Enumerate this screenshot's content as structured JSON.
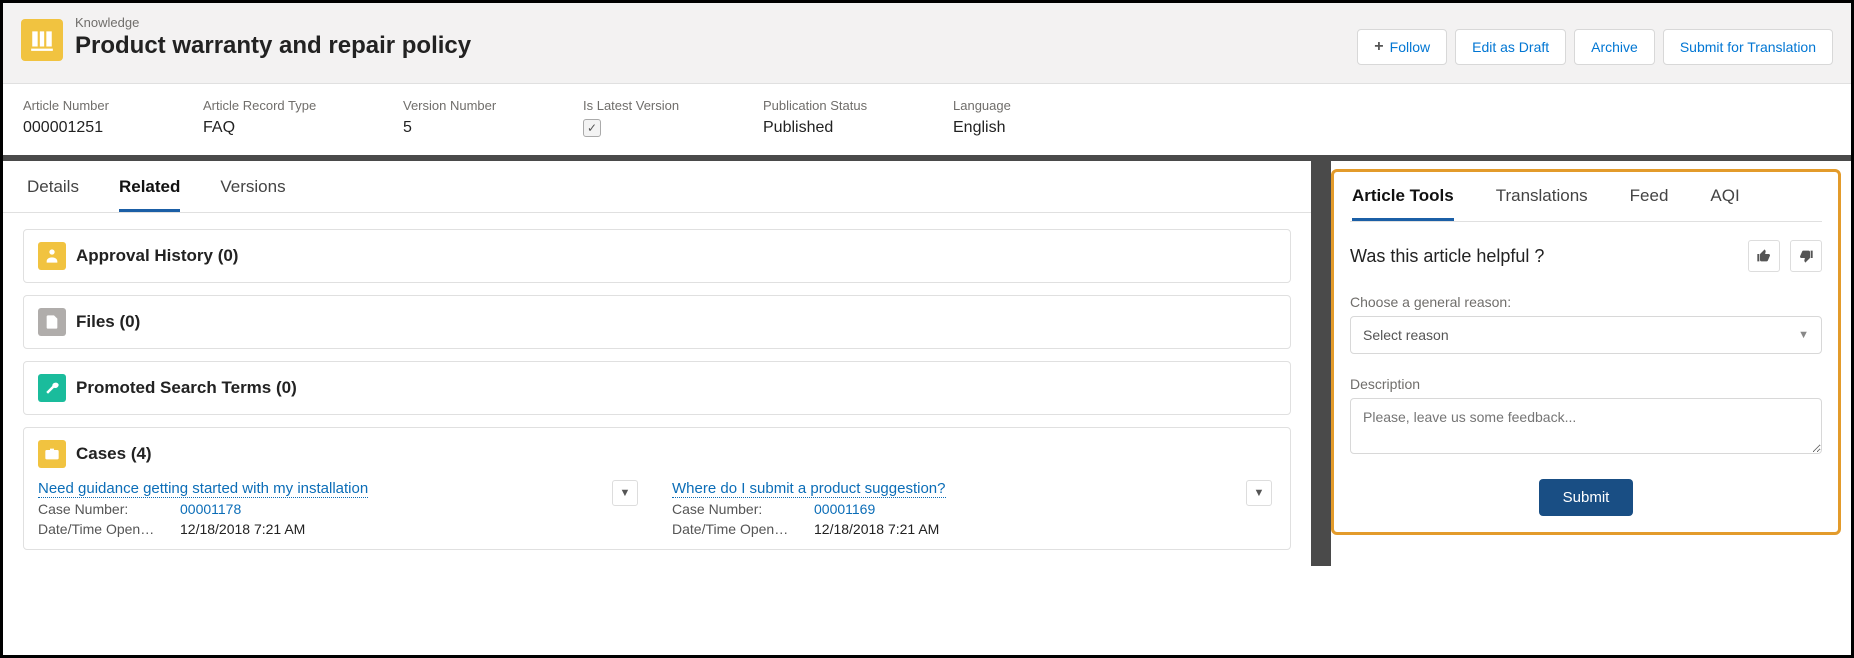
{
  "header": {
    "object_label": "Knowledge",
    "title": "Product warranty and repair policy",
    "actions": {
      "follow": "Follow",
      "edit_draft": "Edit as Draft",
      "archive": "Archive",
      "submit_translation": "Submit for Translation"
    }
  },
  "meta": {
    "article_number": {
      "label": "Article Number",
      "value": "000001251"
    },
    "record_type": {
      "label": "Article Record Type",
      "value": "FAQ"
    },
    "version_number": {
      "label": "Version Number",
      "value": "5"
    },
    "is_latest": {
      "label": "Is Latest Version",
      "checked": true
    },
    "pub_status": {
      "label": "Publication Status",
      "value": "Published"
    },
    "language": {
      "label": "Language",
      "value": "English"
    }
  },
  "tabs": {
    "details": "Details",
    "related": "Related",
    "versions": "Versions"
  },
  "related": {
    "approval": "Approval History (0)",
    "files": "Files (0)",
    "promoted": "Promoted Search Terms (0)",
    "cases_title": "Cases (4)",
    "cases": [
      {
        "title": "Need guidance getting started with my installation",
        "num_label": "Case Number:",
        "num_value": "00001178",
        "dt_label": "Date/Time Open…",
        "dt_value": "12/18/2018 7:21 AM"
      },
      {
        "title": "Where do I submit a product suggestion?",
        "num_label": "Case Number:",
        "num_value": "00001169",
        "dt_label": "Date/Time Open…",
        "dt_value": "12/18/2018 7:21 AM"
      }
    ]
  },
  "right": {
    "tabs": {
      "tools": "Article Tools",
      "translations": "Translations",
      "feed": "Feed",
      "aqi": "AQI"
    },
    "helpful_q": "Was this article helpful ?",
    "reason_label": "Choose a general reason:",
    "reason_placeholder": "Select reason",
    "desc_label": "Description",
    "desc_placeholder": "Please, leave us some feedback...",
    "submit": "Submit"
  }
}
